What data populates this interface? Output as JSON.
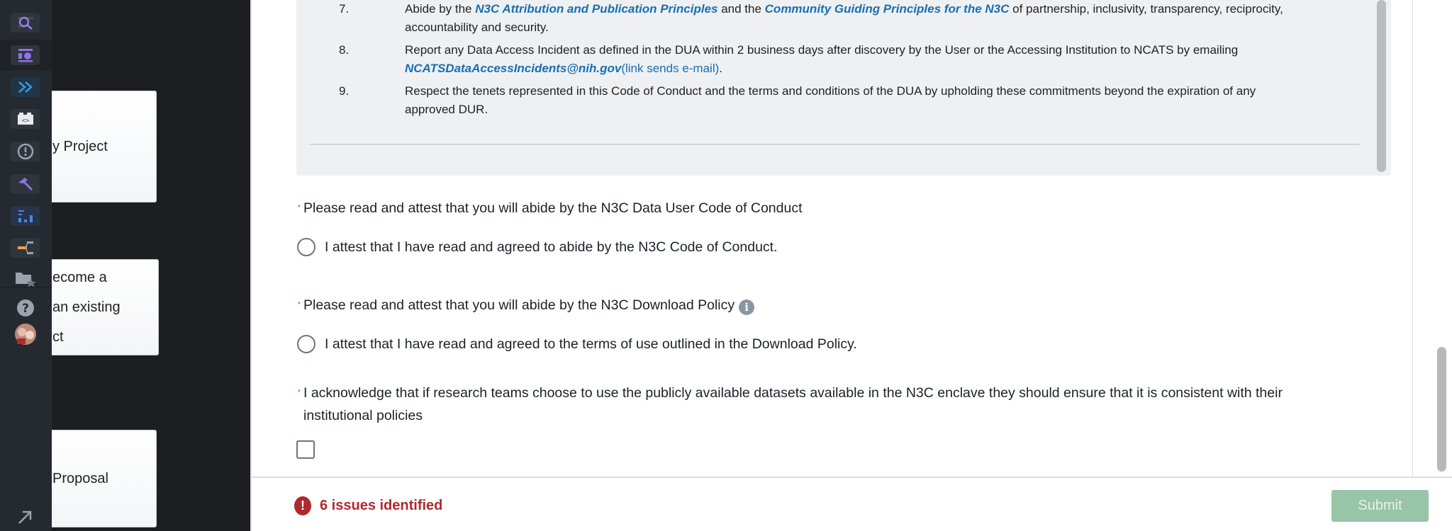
{
  "sidebar": {
    "icons": [
      "search-icon",
      "layout-icon",
      "chevrons-right-icon",
      "code-icon",
      "alert-icon",
      "hammer-icon",
      "chart-icon",
      "pipeline-icon",
      "folder-star-icon",
      "help-icon",
      "avatar",
      "arrow-up-right-icon"
    ]
  },
  "cards": [
    {
      "lines": [
        "y Project"
      ]
    },
    {
      "lines": [
        "ecome a",
        "an existing",
        "ct"
      ]
    },
    {
      "lines": [
        "Proposal"
      ]
    }
  ],
  "code_of_conduct": {
    "items": [
      {
        "num": "7.",
        "pre": "Abide by the ",
        "link1": "N3C Attribution and Publication Principles",
        "mid": " and the ",
        "link2": "Community Guiding Principles for the N3C",
        "post": " of partnership, inclusivity, transparency, reciprocity, accountability and security."
      },
      {
        "num": "8.",
        "pre": "Report any Data Access Incident as defined in the DUA within 2 business days after discovery by the User or the Accessing Institution to NCATS by emailing ",
        "link1": "NCATSDataAccessIncidents@nih.gov",
        "link_note": "(link sends e-mail)",
        "post": "."
      },
      {
        "num": "9.",
        "text": "Respect the tenets represented in this Code of Conduct and the terms and conditions of the DUA by upholding these commitments beyond the expiration of any approved DUR."
      }
    ]
  },
  "form": {
    "required_marker": "*",
    "q1": {
      "label": "Please read and attest that you will abide by the N3C Data User Code of Conduct",
      "option": "I attest that I have read and agreed to abide by the N3C Code of Conduct."
    },
    "q2": {
      "label": "Please read and attest that you will abide by the N3C Download Policy",
      "info": "i",
      "option": "I attest that I have read and agreed to the terms of use outlined in the Download Policy."
    },
    "q3": {
      "label": "I acknowledge that if research teams choose to use the publicly available datasets available in the N3C enclave they should ensure that it is consistent with their institutional policies"
    }
  },
  "footer": {
    "error_icon": "!",
    "issues": "6 issues identified",
    "submit": "Submit"
  },
  "colors": {
    "error": "#b0282e",
    "submit_disabled": "#98c4a8",
    "link": "#1a6fb0"
  }
}
